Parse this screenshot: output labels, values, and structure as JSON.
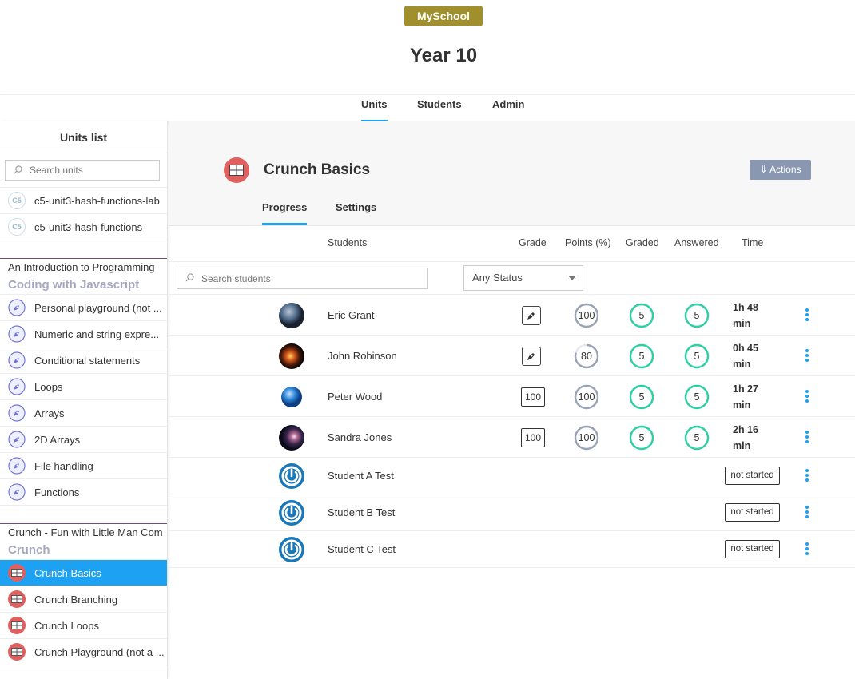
{
  "header": {
    "school": "MySchool",
    "title": "Year 10"
  },
  "topnav": {
    "tabs": [
      "Units",
      "Students",
      "Admin"
    ],
    "active": "Units"
  },
  "sidebar": {
    "title": "Units list",
    "search_placeholder": "Search units",
    "loose_items": [
      {
        "icon": "c5",
        "label": "c5-unit3-hash-functions-lab"
      },
      {
        "icon": "c5",
        "label": "c5-unit3-hash-functions"
      }
    ],
    "groups": [
      {
        "heading": "An Introduction to Programming",
        "subtitle": "Coding with Javascript",
        "items": [
          {
            "label": "Personal playground (not ..."
          },
          {
            "label": "Numeric and string expre..."
          },
          {
            "label": "Conditional statements"
          },
          {
            "label": "Loops"
          },
          {
            "label": "Arrays"
          },
          {
            "label": "2D Arrays"
          },
          {
            "label": "File handling"
          },
          {
            "label": "Functions"
          }
        ]
      },
      {
        "heading": "Crunch - Fun with Little Man Com",
        "subtitle": "Crunch",
        "items": [
          {
            "label": "Crunch Basics",
            "active": true
          },
          {
            "label": "Crunch Branching"
          },
          {
            "label": "Crunch Loops"
          },
          {
            "label": "Crunch Playground (not a ..."
          }
        ]
      }
    ]
  },
  "unit": {
    "title": "Crunch Basics",
    "actions_label": "⇓ Actions",
    "tabs": [
      "Progress",
      "Settings"
    ],
    "active_tab": "Progress"
  },
  "table": {
    "columns": [
      "Students",
      "Grade",
      "Points (%)",
      "Graded",
      "Answered",
      "Time"
    ],
    "search_placeholder": "Search students",
    "status_filter": "Any Status",
    "rows": [
      {
        "name": "Eric Grant",
        "avatar": "earth-photo",
        "grade": "pen-icon",
        "points": 100,
        "graded": 5,
        "answered": 5,
        "time": [
          "1h 48",
          "min"
        ]
      },
      {
        "name": "John Robinson",
        "avatar": "eclipse-photo",
        "grade": "pen-icon",
        "points": 80,
        "graded": 5,
        "answered": 5,
        "time": [
          "0h 45",
          "min"
        ]
      },
      {
        "name": "Peter Wood",
        "avatar": "globe-photo",
        "grade": "100",
        "points": 100,
        "graded": 5,
        "answered": 5,
        "time": [
          "1h 27",
          "min"
        ]
      },
      {
        "name": "Sandra Jones",
        "avatar": "nebula-photo",
        "grade": "100",
        "points": 100,
        "graded": 5,
        "answered": 5,
        "time": [
          "2h 16",
          "min"
        ]
      },
      {
        "name": "Student A Test",
        "avatar": "power-icon",
        "status": "not started"
      },
      {
        "name": "Student B Test",
        "avatar": "power-icon",
        "status": "not started"
      },
      {
        "name": "Student C Test",
        "avatar": "power-icon",
        "status": "not started"
      }
    ]
  },
  "colors": {
    "accent": "#1da1f2",
    "badge": "#a08f2c",
    "ring_grey": "#9aa3b5",
    "ring_green": "#2bd1a4",
    "crunch": "#e06060",
    "js": "#6f72d4"
  }
}
